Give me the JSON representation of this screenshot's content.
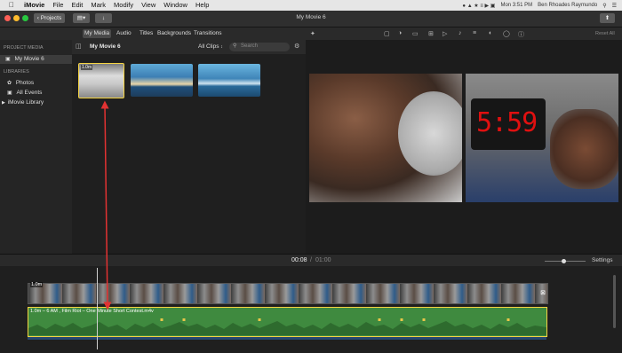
{
  "menubar": {
    "items": [
      "iMovie",
      "File",
      "Edit",
      "Mark",
      "Modify",
      "View",
      "Window",
      "Help"
    ],
    "clock": "Mon 3:51 PM",
    "user": "Ben Rhoades Raymundo"
  },
  "toolbar": {
    "projects_label": "Projects",
    "window_title": "My Movie 6",
    "reset_all": "Reset All"
  },
  "tabs": [
    "My Media",
    "Audio",
    "Titles",
    "Backgrounds",
    "Transitions"
  ],
  "sidebar": {
    "project_media_header": "PROJECT MEDIA",
    "project_item": "My Movie 6",
    "libraries_header": "LIBRARIES",
    "photos": "Photos",
    "all_events": "All Events",
    "imovie_library": "iMovie Library"
  },
  "browser": {
    "title": "My Movie 6",
    "filter": "All Clips",
    "search_placeholder": "Search",
    "clip1_duration": "1.0m"
  },
  "timeline": {
    "time_current": "00:08",
    "time_separator": "/",
    "time_total": "01:00",
    "settings_label": "Settings",
    "clip_duration": "1.0m",
    "audio_label": "1.0m – 6 AM , Film Riot – One Minute Short Contest.m4v"
  },
  "colors": {
    "accent_selection": "#f5d442",
    "audio_green": "#3f8a3f",
    "arrow_red": "#e23232",
    "clock_red": "#e01010"
  }
}
